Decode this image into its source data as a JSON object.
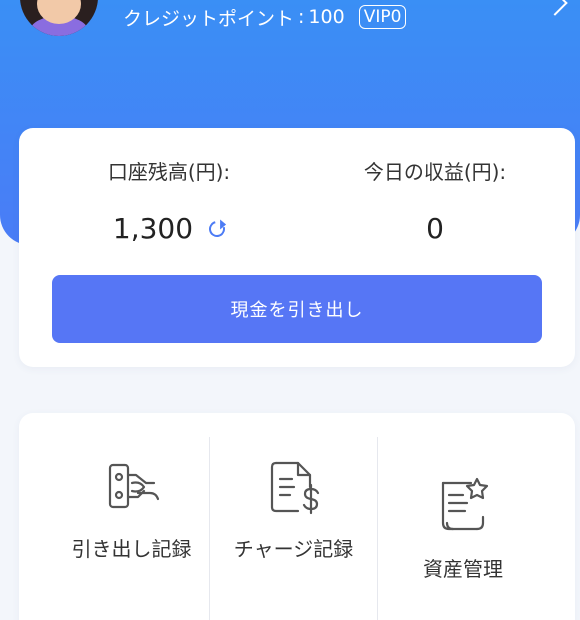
{
  "header": {
    "credit_label": "クレジットポイント",
    "credit_separator": ":",
    "credit_value": "100",
    "vip_badge": "VIP0"
  },
  "balance": {
    "account_label": "口座残高(円):",
    "account_value": "1,300",
    "today_label": "今日の収益(円):",
    "today_value": "0",
    "withdraw_button": "現金を引き出し"
  },
  "menu": {
    "items": [
      {
        "label": "引き出し記録",
        "icon": "withdraw-hand-icon"
      },
      {
        "label": "チャージ記録",
        "icon": "document-dollar-icon"
      },
      {
        "label": "資産管理",
        "icon": "document-star-icon"
      }
    ]
  },
  "colors": {
    "header_gradient_top": "#3a8ff5",
    "header_gradient_bottom": "#4a7cf6",
    "button": "#5676f5",
    "refresh": "#4d7cf5"
  }
}
